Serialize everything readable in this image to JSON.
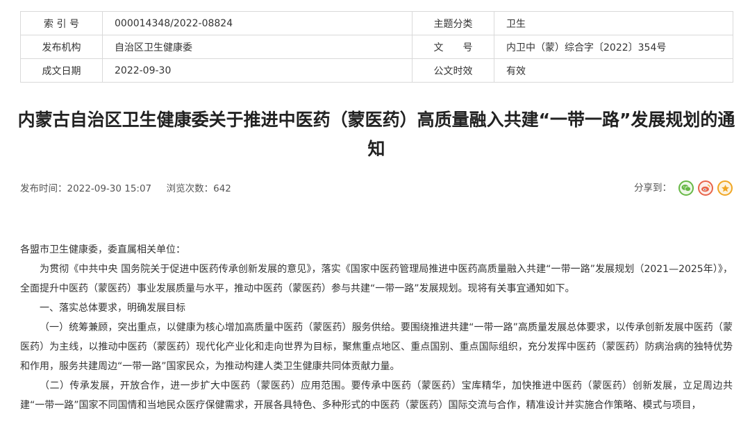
{
  "meta": {
    "index_label": "索 引 号",
    "index_value": "000014348/2022-08824",
    "topic_label": "主题分类",
    "topic_value": "卫生",
    "issuer_label": "发布机构",
    "issuer_value": "自治区卫生健康委",
    "docno_label": "文　　号",
    "docno_value": "内卫中（蒙）综合字〔2022〕354号",
    "date_label": "成文日期",
    "date_value": "2022-09-30",
    "validity_label": "公文时效",
    "validity_value": "有效"
  },
  "title": "内蒙古自治区卫生健康委关于推进中医药（蒙医药）高质量融入共建“一带一路”发展规划的通知",
  "info": {
    "publish_time": "发布时间：2022-09-30 15:07",
    "views": "浏览次数：642",
    "share_label": "分享到："
  },
  "share_icons": {
    "wechat": "wechat-icon",
    "weibo": "weibo-icon",
    "favorite": "star-icon"
  },
  "body": {
    "salutation": "各盟市卫生健康委，委直属相关单位：",
    "p1": "为贯彻《中共中央 国务院关于促进中医药传承创新发展的意见》，落实《国家中医药管理局推进中医药高质量融入共建“一带一路”发展规划（2021—2025年）》，全面提升中医药（蒙医药）事业发展质量与水平，推动中医药（蒙医药）参与共建“一带一路”发展规划。现将有关事宜通知如下。",
    "h1": "一、落实总体要求，明确发展目标",
    "p2": "（一）统筹兼顾，突出重点，以健康为核心增加高质量中医药（蒙医药）服务供给。要围绕推进共建“一带一路”高质量发展总体要求，以传承创新发展中医药（蒙医药）为主线，以推动中医药（蒙医药）现代化产业化和走向世界为目标，聚焦重点地区、重点国别、重点国际组织，充分发挥中医药（蒙医药）防病治病的独特优势和作用，服务共建周边“一带一路”国家民众，为推动构建人类卫生健康共同体贡献力量。",
    "p3": "（二）传承发展，开放合作，进一步扩大中医药（蒙医药）应用范围。要传承中医药（蒙医药）宝库精华，加快推进中医药（蒙医药）创新发展，立足周边共建“一带一路”国家不同国情和当地民众医疗保健需求，开展各具特色、多种形式的中医药（蒙医药）国际交流与合作，精准设计并实施合作策略、模式与项目，"
  }
}
